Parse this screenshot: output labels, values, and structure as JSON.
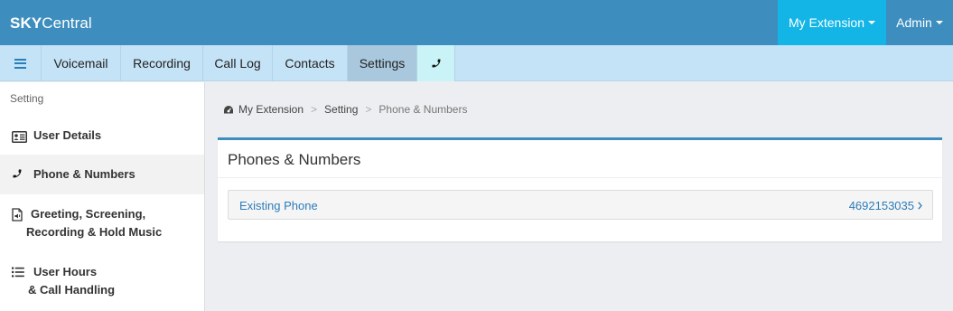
{
  "header": {
    "brand_bold": "SKY",
    "brand_light": "Central",
    "my_extension_label": "My Extension",
    "admin_label": "Admin",
    "accent_color": "#3d8ebe",
    "extension_button_color": "#12b5e5"
  },
  "nav": {
    "menu_icon": "hamburger-icon",
    "tabs": [
      {
        "label": "Voicemail"
      },
      {
        "label": "Recording"
      },
      {
        "label": "Call Log"
      },
      {
        "label": "Contacts"
      },
      {
        "label": "Settings",
        "active": true
      }
    ],
    "phone_tab_icon": "phone-icon"
  },
  "sidebar": {
    "heading": "Setting",
    "items": [
      {
        "icon": "id-card-icon",
        "label": "User Details"
      },
      {
        "icon": "phone-icon",
        "label": "Phone & Numbers",
        "active": true
      },
      {
        "icon": "audio-file-icon",
        "line1": "Greeting, Screening,",
        "line2": "Recording & Hold Music"
      },
      {
        "icon": "list-icon",
        "line1": "User Hours",
        "line2": "& Call Handling"
      }
    ]
  },
  "breadcrumb": {
    "icon": "dashboard-icon",
    "items": [
      "My Extension",
      "Setting",
      "Phone & Numbers"
    ],
    "separator": ">"
  },
  "panel": {
    "title": "Phones & Numbers",
    "rows": [
      {
        "label": "Existing Phone",
        "value": "4692153035",
        "icon": "chevron-right-icon"
      }
    ]
  }
}
